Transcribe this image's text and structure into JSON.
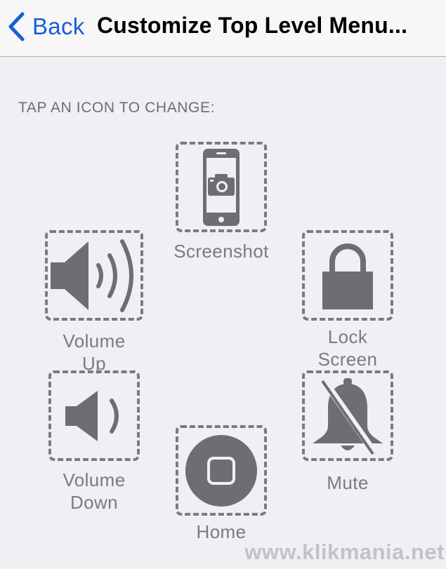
{
  "nav": {
    "back_label": "Back",
    "title": "Customize Top Level Menu..."
  },
  "section_header": "TAP AN ICON TO CHANGE:",
  "items": {
    "screenshot": {
      "label": "Screenshot",
      "icon": "screenshot-icon"
    },
    "lock_screen": {
      "label_line1": "Lock",
      "label_line2": "Screen",
      "icon": "lock-icon"
    },
    "volume_up": {
      "label_line1": "Volume",
      "label_line2": "Up",
      "icon": "volume-up-icon"
    },
    "volume_down": {
      "label_line1": "Volume",
      "label_line2": "Down",
      "icon": "volume-down-icon"
    },
    "mute": {
      "label": "Mute",
      "icon": "bell-slash-icon"
    },
    "home": {
      "label": "Home",
      "icon": "home-button-icon"
    }
  },
  "watermark": "www.klikmania.net",
  "colors": {
    "accent": "#1a5fd1",
    "icon_gray": "#6e6e72",
    "background": "#efeff4"
  }
}
